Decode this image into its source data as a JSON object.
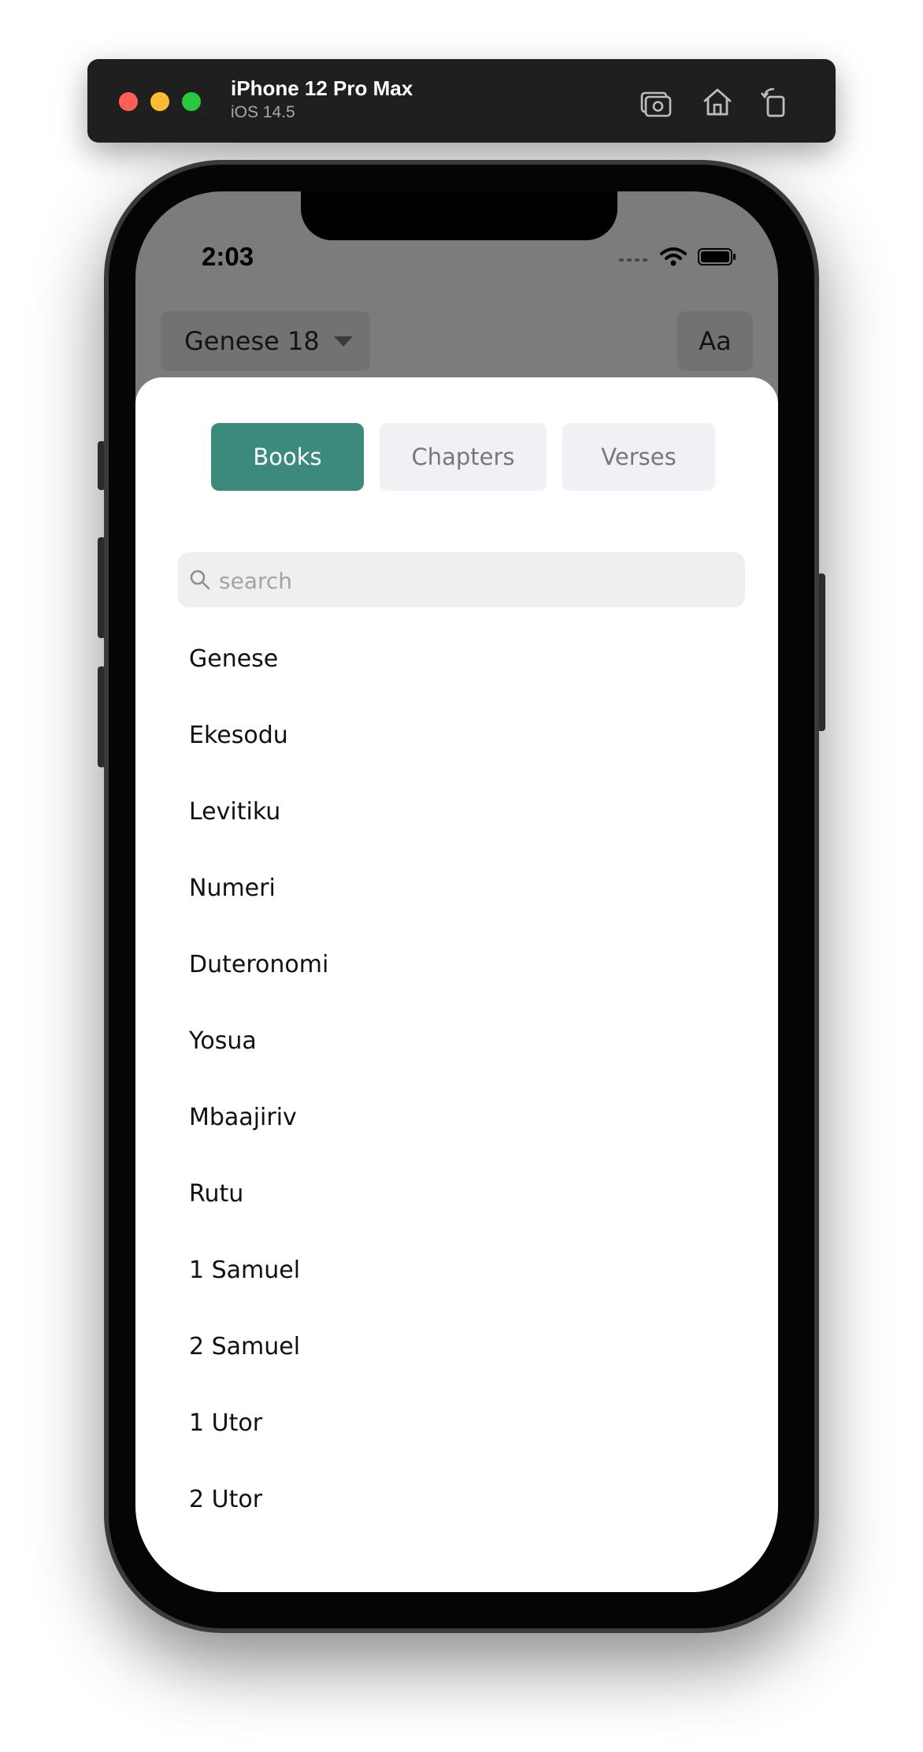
{
  "simulator": {
    "device_name": "iPhone 12 Pro Max",
    "os_version": "iOS 14.5",
    "toolbar_icons": [
      "screenshot-icon",
      "home-icon",
      "rotate-icon"
    ]
  },
  "status_bar": {
    "time": "2:03"
  },
  "nav": {
    "book_selector_label": "Genese 18",
    "font_button_label": "Aa"
  },
  "sheet": {
    "tabs": [
      {
        "label": "Books",
        "active": true
      },
      {
        "label": "Chapters",
        "active": false
      },
      {
        "label": "Verses",
        "active": false
      }
    ],
    "search": {
      "placeholder": "search",
      "value": ""
    },
    "books": [
      "Genese",
      "Ekesodu",
      "Levitiku",
      "Numeri",
      "Duteronomi",
      "Yosua",
      "Mbaajiriv",
      "Rutu",
      "1 Samuel",
      "2 Samuel",
      "1 Utor",
      "2 Utor"
    ]
  },
  "colors": {
    "accent": "#3c8a7c",
    "inactive_tab_bg": "#f1f1f5",
    "overlay": "#7c7c7c"
  }
}
